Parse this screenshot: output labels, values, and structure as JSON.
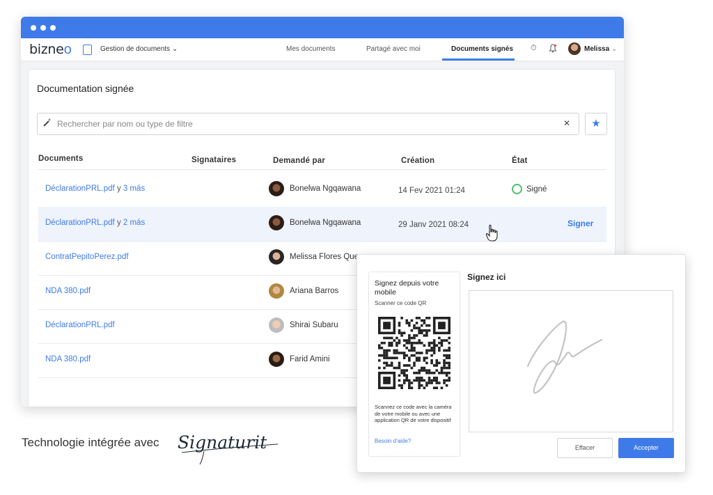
{
  "app": {
    "logo": "bizneo",
    "module": "Gestion de documents",
    "user": "Melissa"
  },
  "tabs": [
    {
      "label": "Mes documents"
    },
    {
      "label": "Partagé avec moi"
    },
    {
      "label": "Documents signés",
      "active": true
    }
  ],
  "page": {
    "title": "Documentation signée"
  },
  "search": {
    "placeholder": "Rechercher par nom ou type de filtre"
  },
  "table": {
    "headers": [
      "Documents",
      "Signataires",
      "Demandé par",
      "Création",
      "État"
    ],
    "rows": [
      {
        "doc": "DéclarationPRL.pdf",
        "extra_y": "y",
        "extra": "3 más",
        "person": "Bonelwa Ngqawana",
        "date": "14 Fev 2021 01:24",
        "state": "Signé",
        "action": ""
      },
      {
        "doc": "DéclarationPRL.pdf",
        "extra_y": "y",
        "extra": "2 más",
        "person": "Bonelwa Ngqawana",
        "date": "29 Janv 2021 08:24",
        "state": "",
        "action": "Signer"
      },
      {
        "doc": "ContratPepitoPerez.pdf",
        "extra_y": "",
        "extra": "",
        "person": "Melissa Flores Que",
        "date": "",
        "state": "",
        "action": ""
      },
      {
        "doc": "NDA 380.pdf",
        "extra_y": "",
        "extra": "",
        "person": "Ariana Barros",
        "date": "",
        "state": "",
        "action": ""
      },
      {
        "doc": "DéclarationPRL.pdf",
        "extra_y": "",
        "extra": "",
        "person": "Shirai Subaru",
        "date": "",
        "state": "",
        "action": ""
      },
      {
        "doc": "NDA 380.pdf",
        "extra_y": "",
        "extra": "",
        "person": "Farid Amini",
        "date": "",
        "state": "",
        "action": ""
      }
    ]
  },
  "popup": {
    "qr_title": "Signez depuis votre mobile",
    "qr_sub": "Scanner ce code QR",
    "qr_desc": "Scannez ce code avec la caméra de votre mobile ou avec une application QR de votre dispositif",
    "qr_help": "Besoin d'aide?",
    "sign_title": "Signez ici",
    "clear_label": "Effacer",
    "accept_label": "Accepter"
  },
  "footer": {
    "text": "Technologie intégrée avec",
    "brand": "Signaturit"
  },
  "colors": {
    "accent": "#3f7be8",
    "success": "#4cc26b",
    "highlight_row": "#eef3fc"
  },
  "icons": [
    "magic-wand-icon",
    "close-icon",
    "star-icon",
    "timer-icon",
    "bell-icon",
    "chevron-down-icon",
    "hand-cursor-icon",
    "qr-code-icon"
  ]
}
